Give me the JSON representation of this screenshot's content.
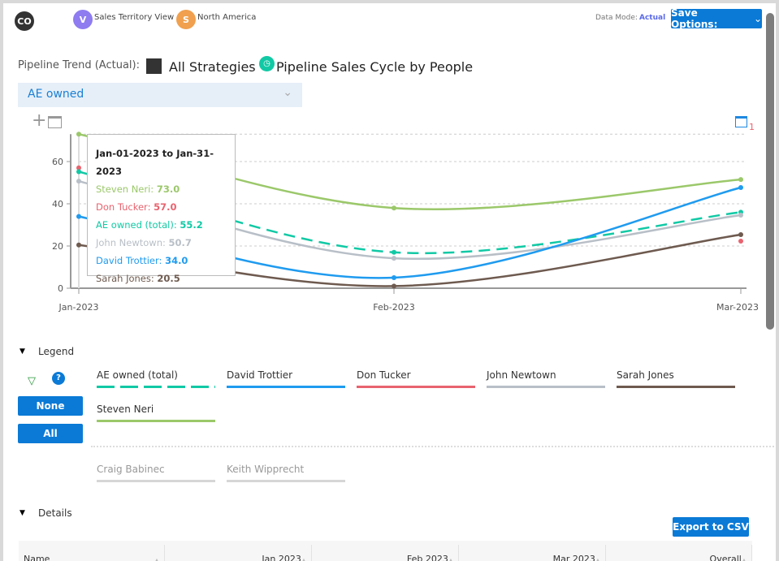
{
  "header": {
    "user_initials": "CO",
    "view_badge": "V",
    "view_label": "Sales Territory View",
    "region_badge": "S",
    "region_label": "North America",
    "data_mode_label": "Data Mode:",
    "data_mode_value": "Actual",
    "save_options": "Save Options:"
  },
  "title": {
    "prefix": "Pipeline Trend (Actual):",
    "strategy": "All Strategies",
    "report": "Pipeline Sales Cycle by People"
  },
  "filter": {
    "selected": "AE owned"
  },
  "calendar_badge": "1",
  "tooltip": {
    "title": "Jan-01-2023 to Jan-31-2023",
    "rows": [
      {
        "name": "Steven Neri:",
        "value": "73.0",
        "color": "#9bc86a"
      },
      {
        "name": "Don Tucker:",
        "value": "57.0",
        "color": "#e8636f"
      },
      {
        "name": "AE owned (total):",
        "value": "55.2",
        "color": "#11c9a5"
      },
      {
        "name": "John Newtown:",
        "value": "50.7",
        "color": "#b8bfc7"
      },
      {
        "name": "David Trottier:",
        "value": "34.0",
        "color": "#1f9bef"
      },
      {
        "name": "Sarah Jones:",
        "value": "20.5",
        "color": "#6e5a4f"
      }
    ]
  },
  "chart_data": {
    "type": "line",
    "categories": [
      "Jan-2023",
      "Feb-2023",
      "Mar-2023"
    ],
    "ylim": [
      0,
      73
    ],
    "yticks": [
      "0",
      "20",
      "40",
      "60"
    ],
    "grid": true,
    "series": [
      {
        "name": "Steven Neri",
        "color": "#9bc86a",
        "dashed": false,
        "values": [
          73.0,
          38,
          51.5
        ]
      },
      {
        "name": "Don Tucker",
        "color": "#e8636f",
        "dashed": false,
        "values": [
          57.0,
          null,
          22.3
        ]
      },
      {
        "name": "AE owned (total)",
        "color": "#11c9a5",
        "dashed": true,
        "values": [
          55.2,
          17,
          36
        ]
      },
      {
        "name": "John Newtown",
        "color": "#b8bfc7",
        "dashed": false,
        "values": [
          50.7,
          14.2,
          34.6
        ]
      },
      {
        "name": "David Trottier",
        "color": "#1f9bef",
        "dashed": false,
        "values": [
          34.0,
          5,
          47.7
        ]
      },
      {
        "name": "Sarah Jones",
        "color": "#6e5a4f",
        "dashed": false,
        "values": [
          20.5,
          1,
          25.4
        ]
      }
    ]
  },
  "legend": {
    "title": "Legend",
    "none": "None",
    "all": "All",
    "items": [
      {
        "label": "AE owned (total)",
        "color": "#11c9a5",
        "dashed": true
      },
      {
        "label": "David Trottier",
        "color": "#1f9bef"
      },
      {
        "label": "Don Tucker",
        "color": "#e8636f"
      },
      {
        "label": "John Newtown",
        "color": "#b8bfc7"
      },
      {
        "label": "Sarah Jones",
        "color": "#6e5a4f"
      },
      {
        "label": "Steven Neri",
        "color": "#9bc86a"
      }
    ],
    "hidden": [
      {
        "label": "Craig Babinec"
      },
      {
        "label": "Keith Wipprecht"
      }
    ]
  },
  "details": {
    "title": "Details",
    "export": "Export to CSV",
    "columns": [
      "Name",
      "Jan 2023",
      "Feb 2023",
      "Mar 2023",
      "Overall"
    ]
  }
}
